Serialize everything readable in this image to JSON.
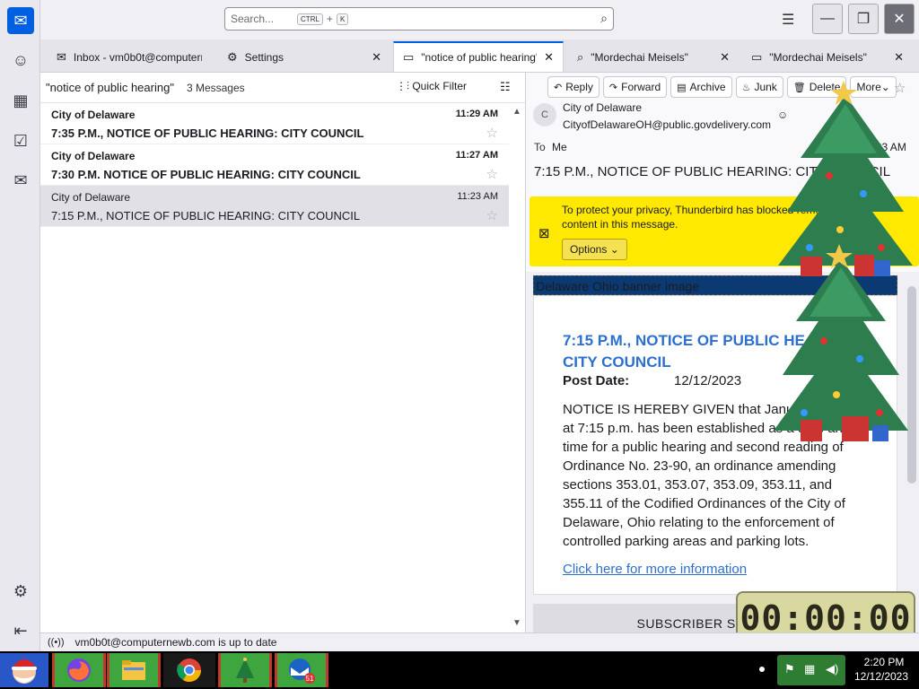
{
  "spaces": {
    "mail_icon": "envelope-icon",
    "items": [
      {
        "name": "address-book",
        "glyph": "☺"
      },
      {
        "name": "calendar",
        "glyph": "▦"
      },
      {
        "name": "tasks",
        "glyph": "☑"
      },
      {
        "name": "chat",
        "glyph": "✉"
      }
    ],
    "settings_glyph": "⚙",
    "collapse_glyph": "⇤"
  },
  "toolbar": {
    "search_placeholder": "Search...",
    "kbd_ctrl": "CTRL",
    "kbd_plus": "+",
    "kbd_k": "K"
  },
  "tabs": [
    {
      "label": "Inbox - vm0b0t@computernewb.com",
      "icon": "✉",
      "closable": false
    },
    {
      "label": "Settings",
      "icon": "⚙",
      "closable": true
    },
    {
      "label": "\"notice of public hearing\"",
      "icon": "▭",
      "closable": true
    },
    {
      "label": "\"Mordechai Meisels\"",
      "icon": "⌕",
      "closable": true
    },
    {
      "label": "\"Mordechai Meisels\"",
      "icon": "▭",
      "closable": true
    }
  ],
  "list": {
    "title": "\"notice of public hearing\"",
    "count": "3 Messages",
    "quick_filter": "Quick Filter",
    "rows": [
      {
        "sender": "City of Delaware",
        "subject": "7:35 P.M., NOTICE OF PUBLIC HEARING: CITY COUNCIL",
        "time": "11:29 AM",
        "unread": true,
        "selected": false
      },
      {
        "sender": "City of Delaware",
        "subject": "7:30 P.M. NOTICE OF PUBLIC HEARING: CITY COUNCIL",
        "time": "11:27 AM",
        "unread": true,
        "selected": false
      },
      {
        "sender": "City of Delaware",
        "subject": "7:15 P.M., NOTICE OF PUBLIC HEARING: CITY COUNCIL",
        "time": "11:23 AM",
        "unread": false,
        "selected": true
      }
    ]
  },
  "message": {
    "actions": {
      "reply": "Reply",
      "forward": "Forward",
      "archive": "Archive",
      "junk": "Junk",
      "delete": "Delete",
      "more": "More"
    },
    "avatar_letter": "C",
    "from_name": "City of Delaware",
    "from_email": "CityofDelawareOH@public.govdelivery.com",
    "to_label": "To",
    "to_value": "Me",
    "time": "11:23 AM",
    "subject": "7:15 P.M., NOTICE OF PUBLIC HEARING: CITY COUNCIL",
    "privacy_text": "To protect your privacy, Thunderbird has blocked remote content in this message.",
    "options": "Options",
    "banner": "Delaware Ohio banner image",
    "card_title": "7:15 P.M., NOTICE OF PUBLIC HEARING: CITY COUNCIL",
    "post_label": "Post Date:",
    "post_date": "12/12/2023",
    "notice": "NOTICE IS HEREBY GIVEN that January 8, 2024 at 7:15 p.m. has been established as a date and time for a public hearing and second reading of Ordinance No. 23-90, an ordinance amending sections 353.01, 353.07, 353.09, 353.11, and 355.11 of the Codified Ordinances of the City of Delaware, Ohio relating to the enforcement of controlled parking areas and parking lots.",
    "more_link": "Click here for more information",
    "subscriber": "SUBSCRIBER SERVICES"
  },
  "status": {
    "text": "vm0b0t@computernewb.com is up to date"
  },
  "timer": {
    "value": "00:00:00"
  },
  "taskbar": {
    "badge": "51",
    "clock_time": "2:20 PM",
    "clock_date": "12/12/2023"
  },
  "colors": {
    "accent": "#0060df",
    "privacy_bar": "#ffe900",
    "link": "#2c6fcf",
    "banner": "#0b3a73"
  }
}
